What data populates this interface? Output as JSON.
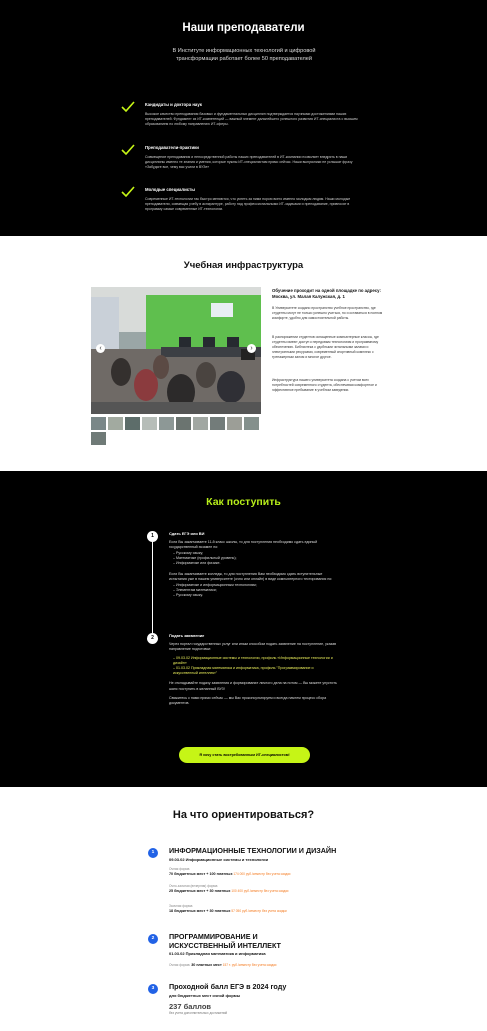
{
  "teachers": {
    "title": "Наши преподаватели",
    "subtitle": "В Институте информационных технологий и цифровой трансформации работает более 50 преподавателей",
    "features": [
      {
        "title": "Кандидаты и доктора наук",
        "text": "Высокое качество преподавания базовых и фундаментальных дисциплин подтверждается научными достижениями наших преподавателей. Фундамент из ИТ-компетенций — важный элемент дальнейшего успешного развития ИТ-специалиста с высшим образованием по любому направлению ИТ-сферы."
      },
      {
        "title": "Преподаватели-практики",
        "text": "Совмещение преподавания и непосредственной работы наших преподавателей в ИТ-компании позволяет внедрять в наши дисциплины именно те знания и умения, которые нужны ИТ-специалистам прямо сейчас. Наши выпускники не услышат фразу «Забудьте все, чему вас учили в ВУЗе»"
      },
      {
        "title": "Молодые специалисты",
        "text": "Современные ИТ-технологии так быстро меняются, что успеть за ними порою всего именно молодым людям. Наши молодые преподаватели, совмещая учебу в аспирантуре, работу над профессиональными ИТ-задачами и преподавание, привносят в программу самые современные ИТ-технологии."
      }
    ]
  },
  "infra": {
    "title": "Учебная инфраструктура",
    "address": "Обучение проходит на одной площадке по адресу: Москва, ул. Малая Калужская, д. 1",
    "paragraphs": [
      "В Университете создано пространство учебное пространство, где студенты могут не только успешно учиться, но и оставаться в полном комфорте, удобно для самостоятельной работы.",
      "В распоряжении студентов оснащенные компьютерные классы, где студенты имеют доступ к передовым технологиям и программному обеспечению. Библиотека с удобными читальными залами и электронными ресурсами, современный спортивный комплекс с тренажерным залом и многое другое.",
      "Инфраструктура нашего университета создана с учетом всех потребностей современного студента, обеспечивая комфортное и эффективное пребывание в учебном заведении."
    ]
  },
  "apply": {
    "title": "Как поступить",
    "step1": {
      "num": "1",
      "title": "Сдать ЕГЭ или ВИ",
      "intro1": "Если Вы заканчиваете 11-й класс школы, то для поступления необходимо сдать единый государственный экзамен по:",
      "list1": [
        "Русскому языку;",
        "Математике (профильный уровень);",
        "Информатике или физике."
      ],
      "intro2": "Если Вы заканчиваете колледж, то для поступления Вам необходимо сдать вступительные испытания уже в нашем университете (очно или онлайн) в виде компьютерного тестирования по:",
      "list2": [
        "Информатике и информационным технологиям;",
        "Элементам математики;",
        "Русскому языку."
      ]
    },
    "step2": {
      "num": "2",
      "title": "Подать заявление",
      "intro": "Через портал государственных услуг или иным способом подать заявление на поступление, указав направление подготовки:",
      "list": [
        "09.03.02 Информационные системы и технологии, профиль «Информационные технологии и дизайн»",
        "01.03.02 Прикладная математика и информатика, профиль \"Программирование и искусственный интеллект\""
      ],
      "note": "Не откладывайте подачу заявления и формирование личного дела на потом — Вы можете упустить шанс поступить в желанный ВУЗ!",
      "note2": "Свяжитесь с нами прямо сейчас — мы Вас проконсультируем и всегда начнем процесс сбора документов."
    },
    "button": "Я хочу стать востребованным ИТ-специалистом!"
  },
  "orient": {
    "title": "На что ориентироваться?",
    "programs": [
      {
        "num": "1",
        "title": "ИНФОРМАЦИОННЫЕ ТЕХНОЛОГИИ И ДИЗАЙН",
        "sub": "09.03.02 Информационные системы и технологии",
        "rows": [
          {
            "label": "Очная форма",
            "value": "70 бюджетных мест + 100 платных",
            "price": "174 000 руб./семестр без учета скидки"
          },
          {
            "label": "Очно-заочная (вечерняя) форма",
            "value": "25 бюджетных мест + 30 платных",
            "price": "100 400 руб./семестр без учета скидки"
          },
          {
            "label": "Заочная форма",
            "value": "18 бюджетных мест + 30 платных",
            "price": "57 050 руб./семестр без учета скидки"
          }
        ]
      },
      {
        "num": "2",
        "title": "ПРОГРАММИРОВАНИЕ И ИСКУССТВЕННЫЙ ИНТЕЛЛЕКТ",
        "sub": "01.03.02 Прикладная математика и информатика",
        "rows": [
          {
            "label": "Очная форма:",
            "value": "30 платных мест",
            "price": "157 т. руб./семестр без учета скидки"
          }
        ]
      },
      {
        "num": "3",
        "title": "Проходной балл ЕГЭ в 2024 году",
        "sub": "для бюджетных мест очной формы",
        "score": "237 баллов",
        "score_note": "без учета дополнительных достижений"
      }
    ]
  },
  "colors": {
    "accent": "#c6f516",
    "blue": "#2162e6",
    "orange": "#f47a1f"
  }
}
